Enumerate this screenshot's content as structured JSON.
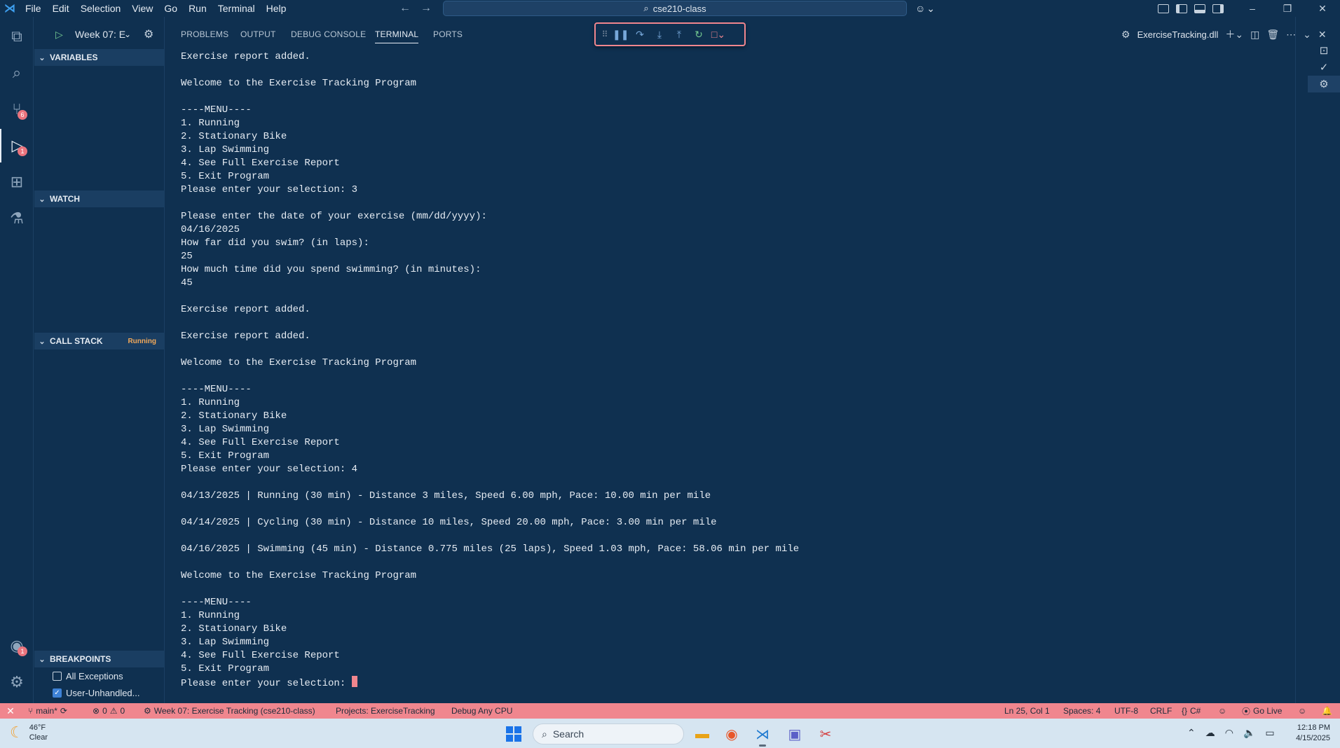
{
  "titlebar": {
    "menu": [
      "File",
      "Edit",
      "Selection",
      "View",
      "Go",
      "Run",
      "Terminal",
      "Help"
    ],
    "command_center": "cse210-class"
  },
  "activity_bar": {
    "items": [
      {
        "name": "explorer-icon",
        "glyph": "⧉"
      },
      {
        "name": "search-icon",
        "glyph": "⌕"
      },
      {
        "name": "source-control-icon",
        "glyph": "⑂",
        "badge": "6"
      },
      {
        "name": "run-debug-icon",
        "glyph": "▷",
        "badge": "1",
        "active": true
      },
      {
        "name": "extensions-icon",
        "glyph": "⊞"
      },
      {
        "name": "testing-icon",
        "glyph": "⚗"
      }
    ],
    "account_badge": "1"
  },
  "sidebar": {
    "config_name": "Week 07: E",
    "sections": {
      "variables": "VARIABLES",
      "watch": "WATCH",
      "call_stack": "CALL STACK",
      "call_stack_state": "Running",
      "breakpoints": "BREAKPOINTS"
    },
    "breakpoints": [
      {
        "label": "All Exceptions",
        "checked": false
      },
      {
        "label": "User-Unhandled...",
        "checked": true
      }
    ]
  },
  "panel": {
    "tabs": [
      "PROBLEMS",
      "OUTPUT",
      "DEBUG CONSOLE",
      "TERMINAL",
      "PORTS"
    ],
    "active_tab": "TERMINAL",
    "terminal_name": "ExerciseTracking.dll"
  },
  "terminal_lines": [
    "Exercise report added.",
    "",
    "Welcome to the Exercise Tracking Program",
    "",
    "----MENU----",
    "1. Running",
    "2. Stationary Bike",
    "3. Lap Swimming",
    "4. See Full Exercise Report",
    "5. Exit Program",
    "Please enter your selection: 3",
    "",
    "Please enter the date of your exercise (mm/dd/yyyy):",
    "04/16/2025",
    "How far did you swim? (in laps):",
    "25",
    "How much time did you spend swimming? (in minutes):",
    "45",
    "",
    "Exercise report added.",
    "",
    "Exercise report added.",
    "",
    "Welcome to the Exercise Tracking Program",
    "",
    "----MENU----",
    "1. Running",
    "2. Stationary Bike",
    "3. Lap Swimming",
    "4. See Full Exercise Report",
    "5. Exit Program",
    "Please enter your selection: 4",
    "",
    "04/13/2025 | Running (30 min) - Distance 3 miles, Speed 6.00 mph, Pace: 10.00 min per mile",
    "",
    "04/14/2025 | Cycling (30 min) - Distance 10 miles, Speed 20.00 mph, Pace: 3.00 min per mile",
    "",
    "04/16/2025 | Swimming (45 min) - Distance 0.775 miles (25 laps), Speed 1.03 mph, Pace: 58.06 min per mile",
    "",
    "Welcome to the Exercise Tracking Program",
    "",
    "----MENU----",
    "1. Running",
    "2. Stationary Bike",
    "3. Lap Swimming",
    "4. See Full Exercise Report",
    "5. Exit Program",
    "Please enter your selection: "
  ],
  "statusbar": {
    "branch": "main*",
    "errors": "0",
    "warnings": "0",
    "launch_config": "Week 07: Exercise Tracking (cse210-class)",
    "projects": "Projects: ExerciseTracking",
    "debug_target": "Debug Any CPU",
    "cursor_position": "Ln 25, Col 1",
    "spaces": "Spaces: 4",
    "encoding": "UTF-8",
    "eol": "CRLF",
    "language": "C#",
    "go_live": "Go Live"
  },
  "taskbar": {
    "temperature": "46°F",
    "condition": "Clear",
    "search_placeholder": "Search",
    "time": "12:18 PM",
    "date": "4/15/2025"
  },
  "colors": {
    "background": "#0f3050",
    "statusbar": "#f0868e",
    "accent": "#3ea0f0"
  }
}
